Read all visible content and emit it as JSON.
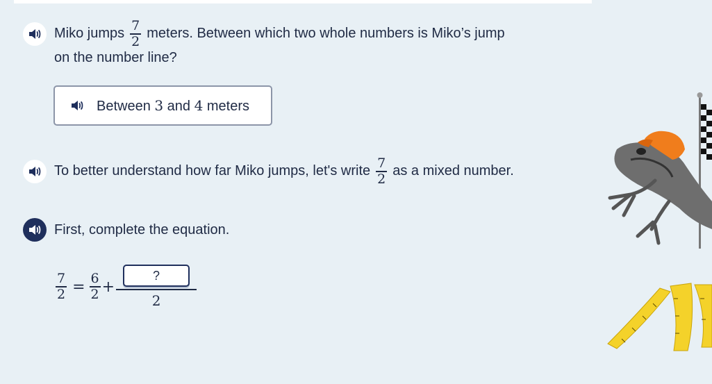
{
  "question": {
    "prefix": "Miko jumps",
    "fraction": {
      "num": "7",
      "den": "2"
    },
    "suffix": "meters. Between which two whole numbers is Miko’s jump",
    "line2": "on the number line?"
  },
  "answer": {
    "pre": "Between ",
    "a": "3",
    "mid": " and ",
    "b": "4",
    "post": " meters"
  },
  "hint": {
    "prefix": "To better understand how far Miko jumps, let's write",
    "fraction": {
      "num": "7",
      "den": "2"
    },
    "suffix": "as a mixed number."
  },
  "instruction": {
    "text": "First, complete the equation."
  },
  "equation": {
    "lhs": {
      "num": "7",
      "den": "2"
    },
    "equals": "=",
    "term1": {
      "num": "6",
      "den": "2"
    },
    "plus": "+",
    "input_placeholder": "?",
    "den2": "2"
  },
  "colors": {
    "background": "#e8f0f5",
    "speaker_active": "#1f2f5c",
    "tape": "#f4d22a",
    "cap": "#f07d1c"
  },
  "icons": [
    "speaker-icon",
    "frog-illustration",
    "checkered-flag",
    "measuring-tape"
  ]
}
